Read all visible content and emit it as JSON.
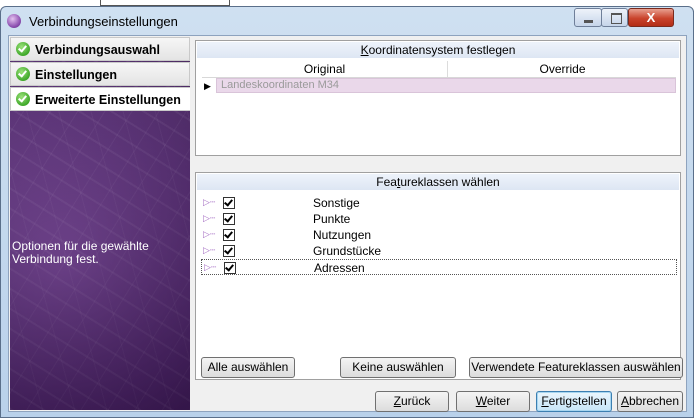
{
  "window": {
    "title": "Verbindungseinstellungen",
    "close_glyph": "X"
  },
  "sidebar": {
    "steps": [
      {
        "label": "Verbindungsauswahl",
        "done": true
      },
      {
        "label": "Einstellungen",
        "done": true
      },
      {
        "label": "Erweiterte Einstellungen",
        "done": true
      }
    ],
    "description": "Optionen für die gewählte Verbindung fest."
  },
  "coordinate_panel": {
    "title_accel": "K",
    "title_rest": "oordinatensystem festlegen",
    "columns": [
      "Original",
      "Override"
    ],
    "row_marker": "▶",
    "row_value": "Landeskoordinaten M34"
  },
  "feature_panel": {
    "title_pre": "Fea",
    "title_accel": "t",
    "title_post": "ureklassen wählen",
    "items": [
      {
        "label": "Sonstige",
        "checked": true
      },
      {
        "label": "Punkte",
        "checked": true
      },
      {
        "label": "Nutzungen",
        "checked": true
      },
      {
        "label": "Grundstücke",
        "checked": true
      },
      {
        "label": "Adressen",
        "checked": true,
        "selected": true
      }
    ],
    "tree_glyph": "▷┄"
  },
  "feature_buttons": {
    "select_all": "Alle auswählen",
    "select_none": "Keine auswählen",
    "select_used": "Verwendete Featureklassen auswählen"
  },
  "nav_buttons": {
    "back_accel": "Z",
    "back_rest": "urück",
    "next_accel": "W",
    "next_rest": "eiter",
    "finish_accel": "F",
    "finish_rest": "ertigstellen",
    "cancel_accel": "A",
    "cancel_rest": "bbrechen"
  }
}
